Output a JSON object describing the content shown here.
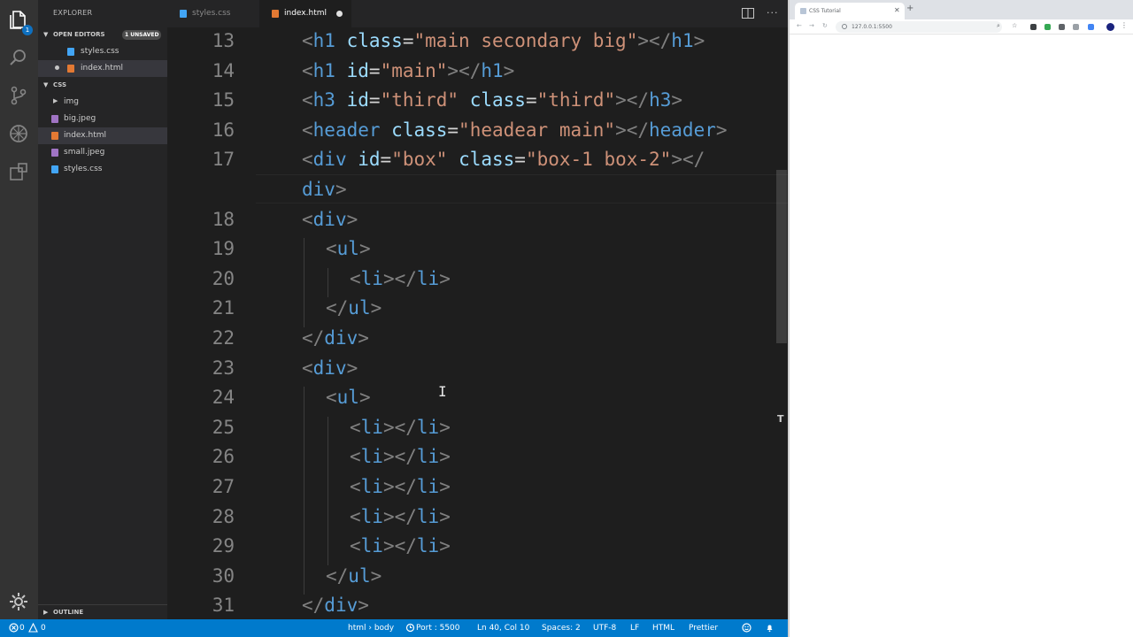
{
  "explorer": {
    "title": "EXPLORER",
    "open_editors": {
      "label": "OPEN EDITORS",
      "badge": "1 UNSAVED",
      "items": [
        {
          "label": "styles.css",
          "kind": "css"
        },
        {
          "label": "index.html",
          "kind": "html"
        }
      ]
    },
    "folder": {
      "label": "CSS",
      "items": [
        {
          "label": "img",
          "kind": "folder"
        },
        {
          "label": "big.jpeg",
          "kind": "image"
        },
        {
          "label": "index.html",
          "kind": "html"
        },
        {
          "label": "small.jpeg",
          "kind": "image"
        },
        {
          "label": "styles.css",
          "kind": "css"
        }
      ]
    },
    "outline_label": "OUTLINE"
  },
  "activity_bar": {
    "icons": [
      "files-icon",
      "search-icon",
      "source-control-icon",
      "debug-icon",
      "extensions-icon"
    ],
    "badge": "1",
    "settings_icon": "gear-icon"
  },
  "tabs": [
    {
      "label": "styles.css",
      "active": false
    },
    {
      "label": "index.html",
      "active": true,
      "modified": true
    }
  ],
  "editor": {
    "lines": [
      {
        "num": "13",
        "indent": 0,
        "tokens": [
          [
            "br",
            "<"
          ],
          [
            "tag",
            "h1"
          ],
          [
            "sp",
            " "
          ],
          [
            "attr",
            "class"
          ],
          [
            "eq",
            "="
          ],
          [
            "str",
            "\"main secondary big\""
          ],
          [
            "br",
            "></"
          ],
          [
            "tag",
            "h1"
          ],
          [
            "br",
            ">"
          ]
        ]
      },
      {
        "num": "14",
        "indent": 0,
        "tokens": [
          [
            "br",
            "<"
          ],
          [
            "tag",
            "h1"
          ],
          [
            "sp",
            " "
          ],
          [
            "attr",
            "id"
          ],
          [
            "eq",
            "="
          ],
          [
            "str",
            "\"main\""
          ],
          [
            "br",
            "></"
          ],
          [
            "tag",
            "h1"
          ],
          [
            "br",
            ">"
          ]
        ]
      },
      {
        "num": "15",
        "indent": 0,
        "tokens": [
          [
            "br",
            "<"
          ],
          [
            "tag",
            "h3"
          ],
          [
            "sp",
            " "
          ],
          [
            "attr",
            "id"
          ],
          [
            "eq",
            "="
          ],
          [
            "str",
            "\"third\""
          ],
          [
            "sp",
            " "
          ],
          [
            "attr",
            "class"
          ],
          [
            "eq",
            "="
          ],
          [
            "str",
            "\"third\""
          ],
          [
            "br",
            "></"
          ],
          [
            "tag",
            "h3"
          ],
          [
            "br",
            ">"
          ]
        ]
      },
      {
        "num": "16",
        "indent": 0,
        "tokens": [
          [
            "br",
            "<"
          ],
          [
            "tag",
            "header"
          ],
          [
            "sp",
            " "
          ],
          [
            "attr",
            "class"
          ],
          [
            "eq",
            "="
          ],
          [
            "str",
            "\"headear main\""
          ],
          [
            "br",
            "></"
          ],
          [
            "tag",
            "header"
          ],
          [
            "br",
            ">"
          ]
        ]
      },
      {
        "num": "17",
        "indent": 0,
        "tokens": [
          [
            "br",
            "<"
          ],
          [
            "tag",
            "div"
          ],
          [
            "sp",
            " "
          ],
          [
            "attr",
            "id"
          ],
          [
            "eq",
            "="
          ],
          [
            "str",
            "\"box\""
          ],
          [
            "sp",
            " "
          ],
          [
            "attr",
            "class"
          ],
          [
            "eq",
            "="
          ],
          [
            "str",
            "\"box-1 box-2\""
          ],
          [
            "br",
            "></"
          ]
        ]
      },
      {
        "num": "",
        "indent": 0,
        "tokens": [
          [
            "tag",
            "div"
          ],
          [
            "br",
            ">"
          ]
        ]
      },
      {
        "num": "18",
        "indent": 0,
        "tokens": [
          [
            "br",
            "<"
          ],
          [
            "tag",
            "div"
          ],
          [
            "br",
            ">"
          ]
        ]
      },
      {
        "num": "19",
        "indent": 1,
        "tokens": [
          [
            "br",
            "<"
          ],
          [
            "tag",
            "ul"
          ],
          [
            "br",
            ">"
          ]
        ]
      },
      {
        "num": "20",
        "indent": 2,
        "tokens": [
          [
            "br",
            "<"
          ],
          [
            "tag",
            "li"
          ],
          [
            "br",
            "></"
          ],
          [
            "tag",
            "li"
          ],
          [
            "br",
            ">"
          ]
        ]
      },
      {
        "num": "21",
        "indent": 1,
        "tokens": [
          [
            "br",
            "</"
          ],
          [
            "tag",
            "ul"
          ],
          [
            "br",
            ">"
          ]
        ]
      },
      {
        "num": "22",
        "indent": 0,
        "tokens": [
          [
            "br",
            "</"
          ],
          [
            "tag",
            "div"
          ],
          [
            "br",
            ">"
          ]
        ]
      },
      {
        "num": "23",
        "indent": 0,
        "tokens": [
          [
            "br",
            "<"
          ],
          [
            "tag",
            "div"
          ],
          [
            "br",
            ">"
          ]
        ]
      },
      {
        "num": "24",
        "indent": 1,
        "tokens": [
          [
            "br",
            "<"
          ],
          [
            "tag",
            "ul"
          ],
          [
            "br",
            ">"
          ]
        ]
      },
      {
        "num": "25",
        "indent": 2,
        "tokens": [
          [
            "br",
            "<"
          ],
          [
            "tag",
            "li"
          ],
          [
            "br",
            "></"
          ],
          [
            "tag",
            "li"
          ],
          [
            "br",
            ">"
          ]
        ]
      },
      {
        "num": "26",
        "indent": 2,
        "tokens": [
          [
            "br",
            "<"
          ],
          [
            "tag",
            "li"
          ],
          [
            "br",
            "></"
          ],
          [
            "tag",
            "li"
          ],
          [
            "br",
            ">"
          ]
        ]
      },
      {
        "num": "27",
        "indent": 2,
        "tokens": [
          [
            "br",
            "<"
          ],
          [
            "tag",
            "li"
          ],
          [
            "br",
            "></"
          ],
          [
            "tag",
            "li"
          ],
          [
            "br",
            ">"
          ]
        ]
      },
      {
        "num": "28",
        "indent": 2,
        "tokens": [
          [
            "br",
            "<"
          ],
          [
            "tag",
            "li"
          ],
          [
            "br",
            "></"
          ],
          [
            "tag",
            "li"
          ],
          [
            "br",
            ">"
          ]
        ]
      },
      {
        "num": "29",
        "indent": 2,
        "tokens": [
          [
            "br",
            "<"
          ],
          [
            "tag",
            "li"
          ],
          [
            "br",
            "></"
          ],
          [
            "tag",
            "li"
          ],
          [
            "br",
            ">"
          ]
        ]
      },
      {
        "num": "30",
        "indent": 1,
        "tokens": [
          [
            "br",
            "</"
          ],
          [
            "tag",
            "ul"
          ],
          [
            "br",
            ">"
          ]
        ]
      },
      {
        "num": "31",
        "indent": 0,
        "tokens": [
          [
            "br",
            "</"
          ],
          [
            "tag",
            "div"
          ],
          [
            "br",
            ">"
          ]
        ]
      }
    ]
  },
  "browser": {
    "tab_title": "CSS Tutorial",
    "address": "127.0.0.1:5500"
  },
  "status_bar": {
    "errors": "0",
    "warnings": "0",
    "breadcrumb": "html › body",
    "port": "Port : 5500",
    "position": "Ln 40, Col 10",
    "spaces": "Spaces: 2",
    "encoding": "UTF-8",
    "eol": "LF",
    "language": "HTML",
    "formatter": "Prettier"
  },
  "colors": {
    "accent": "#007acc",
    "tag": "#569cd6",
    "attribute": "#9cdcfe",
    "string": "#ce9178",
    "bracket": "#808080"
  }
}
